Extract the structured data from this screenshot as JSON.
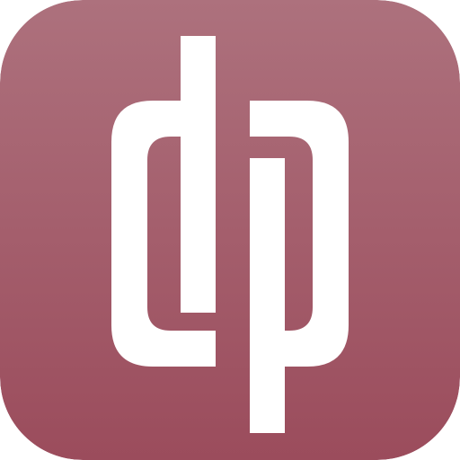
{
  "icon": {
    "name": "app-logo-icon",
    "colors": {
      "background_top": "#ad717d",
      "background_bottom": "#9b4c5c",
      "glyph": "#ffffff"
    }
  }
}
